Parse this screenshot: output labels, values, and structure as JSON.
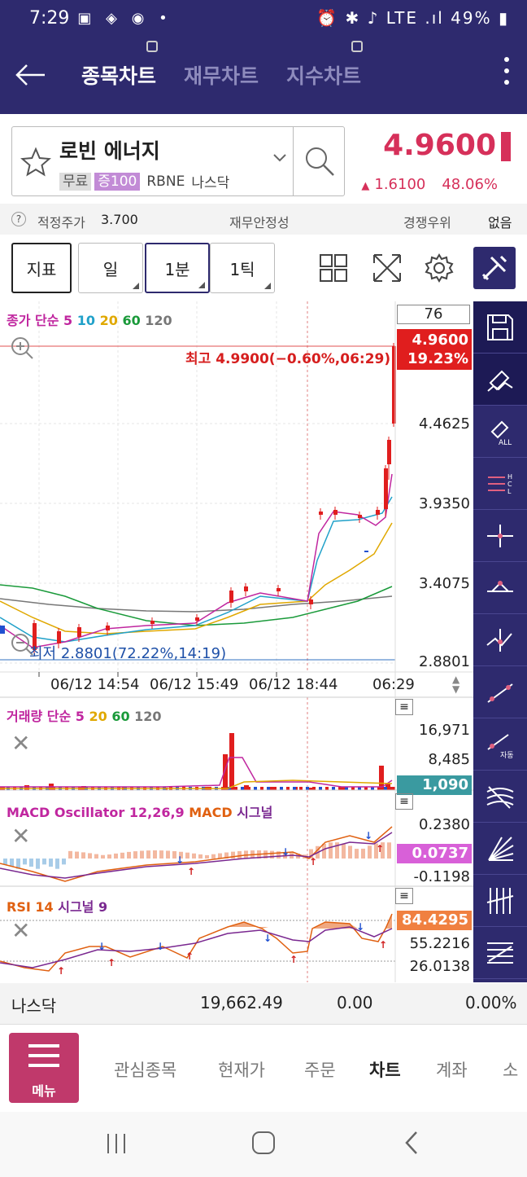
{
  "status_bar": {
    "time": "7:29",
    "battery": "49%",
    "network": "LTE"
  },
  "header": {
    "tabs": [
      {
        "label": "종목차트"
      },
      {
        "label": "재무차트"
      },
      {
        "label": "지수차트"
      }
    ]
  },
  "stock": {
    "name": "로빈 에너지",
    "tags": [
      "무료",
      "증100"
    ],
    "ticker": "RBNE",
    "exchange": "나스닥",
    "price": "4.9600",
    "change": "1.6100",
    "change_pct": "48.06%"
  },
  "info": {
    "fair_price_label": "적정주가",
    "fair_price_value": "3.700",
    "financial_label": "재무안정성",
    "competitive_label": "경쟁우위",
    "competitive_value": "없음"
  },
  "toolbar": {
    "indicator": "지표",
    "day": "일",
    "minute": "1분",
    "tick": "1틱"
  },
  "chart": {
    "legend_price_prefix": "종가 단순",
    "ma": [
      {
        "label": "5",
        "color": "#c0269f"
      },
      {
        "label": "10",
        "color": "#21a1c9"
      },
      {
        "label": "20",
        "color": "#e0a800"
      },
      {
        "label": "60",
        "color": "#1a9a3a"
      },
      {
        "label": "120",
        "color": "#777777"
      }
    ],
    "count_box": "76",
    "current_price_tag": "4.9600",
    "current_pct_tag": "19.23%",
    "high_label": "최고 4.9900(−0.60%,06:29)",
    "low_label": "최저 2.8801(72.22%,14:19)",
    "y_ticks": [
      "4.4625",
      "3.9350",
      "3.4075",
      "2.8801"
    ],
    "x_ticks": [
      "06/12 14:54",
      "06/12 15:49",
      "06/12 18:44",
      "06:29"
    ],
    "volume_legend_prefix": "거래량 단순",
    "volume_ma": [
      {
        "label": "5",
        "color": "#c0269f"
      },
      {
        "label": "20",
        "color": "#e0a800"
      },
      {
        "label": "60",
        "color": "#1a9a3a"
      },
      {
        "label": "120",
        "color": "#777777"
      }
    ],
    "volume_ticks": [
      "16,971",
      "8,485"
    ],
    "volume_tag": "1,090",
    "macd_legend": {
      "osc": "MACD Oscillator 12,26,9",
      "macd": "MACD",
      "signal": "시그널"
    },
    "macd_ticks": [
      "0.2380",
      "-0.1198"
    ],
    "macd_tag": "0.0737",
    "rsi_legend": {
      "rsi": "RSI 14",
      "signal": "시그널 9"
    },
    "rsi_tag": "84.4295",
    "rsi_ticks": [
      "55.2216",
      "26.0138"
    ]
  },
  "index_bar": {
    "name": "나스닥",
    "value": "19,662.49",
    "change": "0.00",
    "pct": "0.00%"
  },
  "bottom_nav": {
    "menu_label": "메뉴",
    "items": [
      {
        "label": "관심종목"
      },
      {
        "label": "현재가"
      },
      {
        "label": "주문"
      },
      {
        "label": "차트"
      },
      {
        "label": "계좌"
      },
      {
        "label": "소"
      }
    ]
  },
  "colors": {
    "header_bg": "#2e2a6e",
    "up": "#d6305a",
    "candle_up": "#e01e1e",
    "menu": "#c0396b"
  }
}
